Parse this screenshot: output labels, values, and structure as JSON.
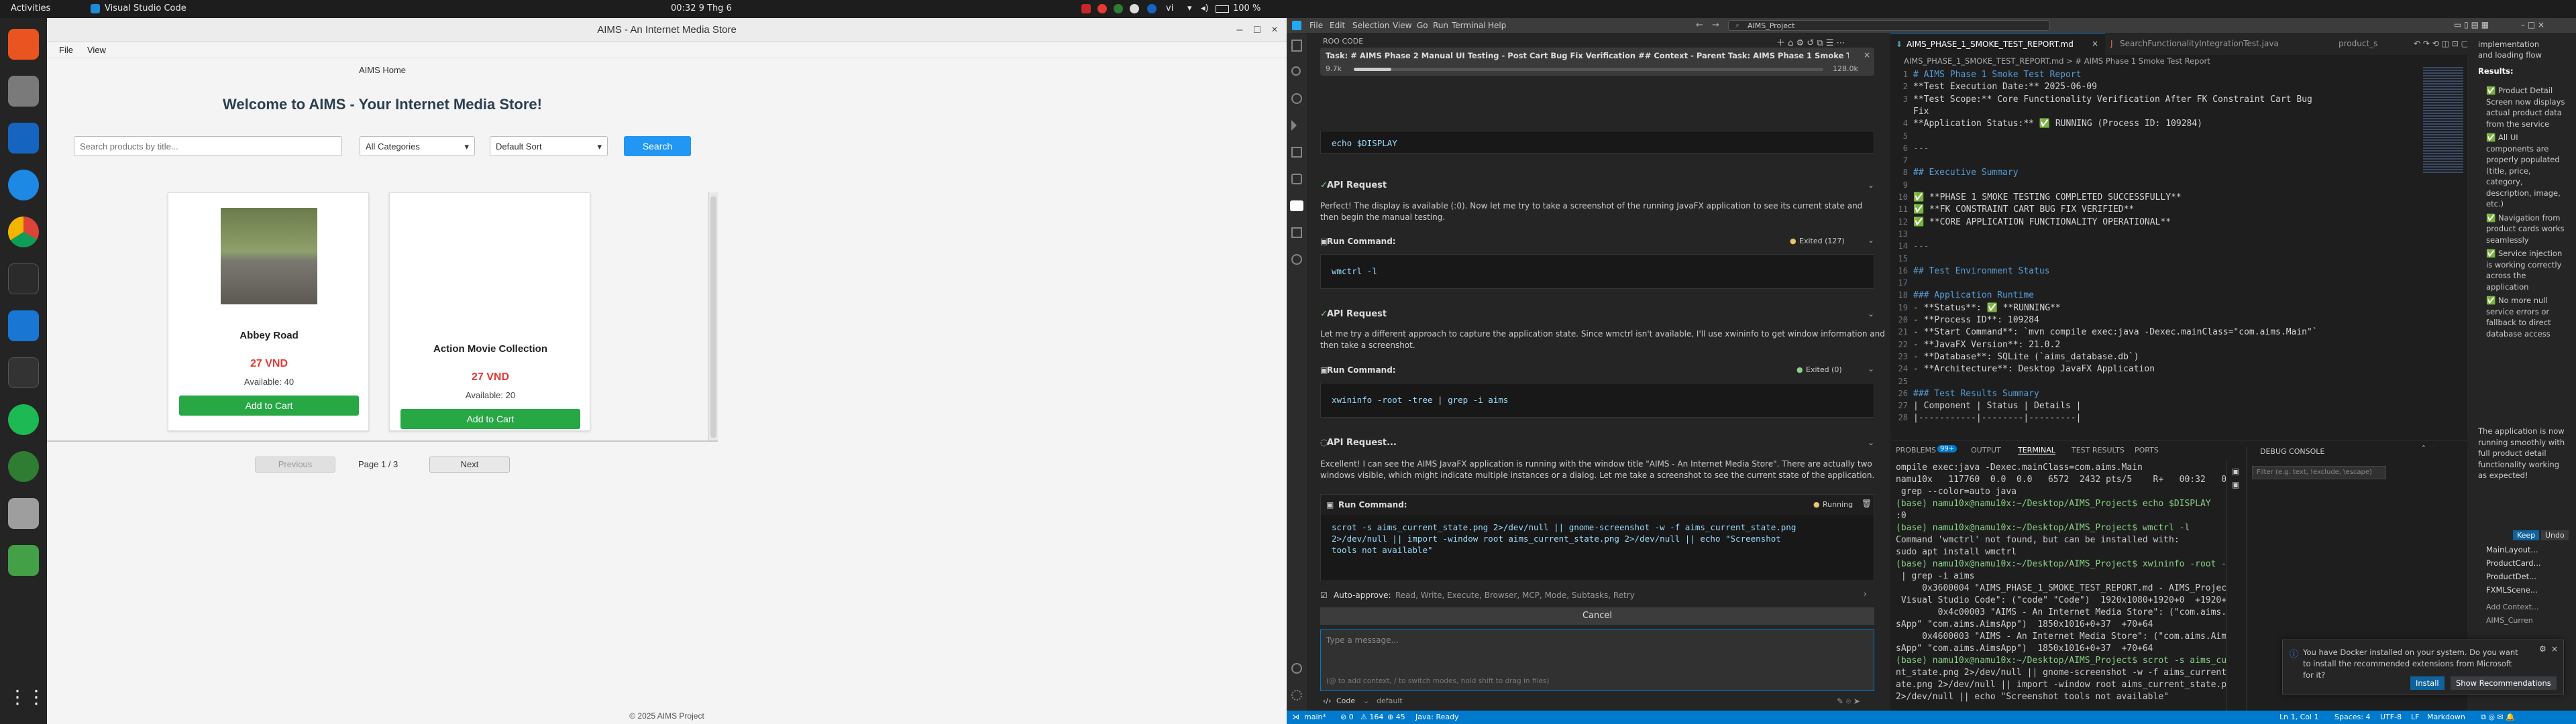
{
  "topbar": {
    "activities": "Activities",
    "app_name": "Visual Studio Code",
    "clock": "00:32  9 Thg 6",
    "lang": "vi",
    "battery": "100 %"
  },
  "dock": {
    "items": [
      "ubuntu-software-icon",
      "files-icon",
      "writer-icon",
      "help-icon",
      "chrome-icon",
      "terminal-icon",
      "vscode-icon",
      "monitor-icon",
      "spotify-icon",
      "xmind-icon",
      "disk-icon",
      "trash-icon",
      "show-apps-icon"
    ]
  },
  "aims": {
    "window_title": "AIMS - An Internet Media Store",
    "menu": [
      "File",
      "View"
    ],
    "header": "AIMS Home",
    "welcome": "Welcome to AIMS - Your Internet Media Store!",
    "search_placeholder": "Search products by title...",
    "category": "All Categories",
    "sort": "Default Sort",
    "search_btn": "Search",
    "products": [
      {
        "title": "Abbey Road",
        "price": "27 VND",
        "available": "Available: 40",
        "button": "Add to Cart"
      },
      {
        "title": "Action Movie Collection",
        "price": "27 VND",
        "available": "Available: 20",
        "button": "Add to Cart"
      }
    ],
    "pagination": {
      "prev": "Previous",
      "page": "Page 1 / 3",
      "next": "Next"
    },
    "footer": "© 2025 AIMS Project"
  },
  "vscode": {
    "menu": [
      "File",
      "Edit",
      "Selection",
      "View",
      "Go",
      "Run",
      "Terminal",
      "Help"
    ],
    "search": "AIMS_Project",
    "roo": {
      "title": "ROO CODE",
      "task": "Task: # AIMS Phase 2 Manual UI Testing - Post Cart Bug Fix Verification ## Context - Parent Task: AIMS Phase 1 Smoke Testing - C...",
      "tokens": "9.7k",
      "ctx": "128.0k",
      "cmd_echo": "echo $DISPLAY",
      "api1": "API Request",
      "msg1": "Perfect! The display is available (:0). Now let me try to take a screenshot of the running JavaFX application to see its current state and then begin the manual testing.",
      "run1": "Run Command:",
      "run1_status": "Exited (127)",
      "cmd1": "wmctrl -l",
      "api2": "API Request",
      "msg2a": "Let me try a different approach to capture the application state. Since wmctrl isn't available, I'll use xwininfo to get window information and",
      "msg2b": "then take a screenshot.",
      "run2": "Run Command:",
      "run2_status": "Exited (0)",
      "cmd2": "xwininfo -root -tree | grep -i aims",
      "api3": "API Request...",
      "msg3a": "Excellent! I can see the AIMS JavaFX application is running with the window title \"AIMS - An Internet Media Store\". There are actually two",
      "msg3b": "windows visible, which might indicate multiple instances or a dialog. Let me take a screenshot to see the current state of the application.",
      "run3": "Run Command:",
      "run3_status": "Running",
      "cmd3a": "scrot -s aims_current_state.png 2>/dev/null || gnome-screenshot -w -f aims_current_state.png",
      "cmd3b": "2>/dev/null || import -window root aims_current_state.png 2>/dev/null || echo \"Screenshot",
      "cmd3c": "tools not available\"",
      "auto": "Auto-approve:",
      "auto_list": "Read, Write, Execute, Browser, MCP, Mode, Subtasks, Retry",
      "cancel": "Cancel",
      "placeholder": "Type a message...",
      "hint": "(@ to add context, / to switch modes, hold shift to drag in files)",
      "mode": "Code",
      "profile": "default"
    },
    "tabs": [
      "AIMS_PHASE_1_SMOKE_TEST_REPORT.md",
      "SearchFunctionalityIntegrationTest.java",
      "product_s"
    ],
    "breadcrumb": "AIMS_PHASE_1_SMOKE_TEST_REPORT.md > # AIMS Phase 1 Smoke Test Report",
    "editor_lines": [
      {
        "n": "1",
        "t": "# AIMS Phase 1 Smoke Test Report",
        "c": "#569cd6"
      },
      {
        "n": "2",
        "t": "**Test Execution Date:** 2025-06-09",
        "c": "#d4d4d4"
      },
      {
        "n": "3",
        "t": "**Test Scope:** Core Functionality Verification After FK Constraint Cart Bug",
        "c": "#d4d4d4"
      },
      {
        "n": "",
        "t": "Fix",
        "c": "#d4d4d4"
      },
      {
        "n": "4",
        "t": "**Application Status:** ✅ RUNNING (Process ID: 109284)",
        "c": "#d4d4d4"
      },
      {
        "n": "5",
        "t": "",
        "c": "#d4d4d4"
      },
      {
        "n": "6",
        "t": "---",
        "c": "#808080"
      },
      {
        "n": "7",
        "t": "",
        "c": "#d4d4d4"
      },
      {
        "n": "8",
        "t": "## Executive Summary",
        "c": "#569cd6"
      },
      {
        "n": "9",
        "t": "",
        "c": "#d4d4d4"
      },
      {
        "n": "10",
        "t": "✅ **PHASE 1 SMOKE TESTING COMPLETED SUCCESSFULLY**",
        "c": "#d4d4d4"
      },
      {
        "n": "11",
        "t": "✅ **FK CONSTRAINT CART BUG FIX VERIFIED**",
        "c": "#d4d4d4"
      },
      {
        "n": "12",
        "t": "✅ **CORE APPLICATION FUNCTIONALITY OPERATIONAL**",
        "c": "#d4d4d4"
      },
      {
        "n": "13",
        "t": "",
        "c": "#d4d4d4"
      },
      {
        "n": "14",
        "t": "---",
        "c": "#808080"
      },
      {
        "n": "15",
        "t": "",
        "c": "#d4d4d4"
      },
      {
        "n": "16",
        "t": "## Test Environment Status",
        "c": "#569cd6"
      },
      {
        "n": "17",
        "t": "",
        "c": "#d4d4d4"
      },
      {
        "n": "18",
        "t": "### Application Runtime",
        "c": "#569cd6"
      },
      {
        "n": "19",
        "t": "- **Status**: ✅ **RUNNING**",
        "c": "#d4d4d4"
      },
      {
        "n": "20",
        "t": "- **Process ID**: 109284",
        "c": "#d4d4d4"
      },
      {
        "n": "21",
        "t": "- **Start Command**: `mvn compile exec:java -Dexec.mainClass=\"com.aims.Main\"`",
        "c": "#d4d4d4"
      },
      {
        "n": "22",
        "t": "- **JavaFX Version**: 21.0.2",
        "c": "#d4d4d4"
      },
      {
        "n": "23",
        "t": "- **Database**: SQLite (`aims_database.db`)",
        "c": "#d4d4d4"
      },
      {
        "n": "24",
        "t": "- **Architecture**: Desktop JavaFX Application",
        "c": "#d4d4d4"
      },
      {
        "n": "25",
        "t": "",
        "c": "#d4d4d4"
      },
      {
        "n": "26",
        "t": "### Test Results Summary",
        "c": "#569cd6"
      },
      {
        "n": "27",
        "t": "| Component | Status | Details |",
        "c": "#d4d4d4"
      },
      {
        "n": "28",
        "t": "|-----------|--------|---------|",
        "c": "#d4d4d4"
      }
    ],
    "panel_tabs": [
      "PROBLEMS",
      "OUTPUT",
      "TERMINAL",
      "TEST RESULTS",
      "PORTS"
    ],
    "problems_count": "99+",
    "terminal_lines": [
      "ompile exec:java -Dexec.mainClass=com.aims.Main",
      "namu10x   117760  0.0  0.0   6572  2432 pts/5    R+   00:32   0:00",
      " grep --color=auto java",
      "(base) namu10x@namu10x:~/Desktop/AIMS_Project$ echo $DISPLAY",
      ":0",
      "(base) namu10x@namu10x:~/Desktop/AIMS_Project$ wmctrl -l",
      "Command 'wmctrl' not found, but can be installed with:",
      "sudo apt install wmctrl",
      "(base) namu10x@namu10x:~/Desktop/AIMS_Project$ xwininfo -root -tree",
      " | grep -i aims",
      "     0x3600004 \"AIMS_PHASE_1_SMOKE_TEST_REPORT.md - AIMS_Project -",
      " Visual Studio Code\": (\"code\" \"Code\")  1920x1080+1920+0  +1920+0",
      "        0x4c00003 \"AIMS - An Internet Media Store\": (\"com.aims.Aim",
      "sApp\" \"com.aims.AimsApp\")  1850x1016+0+37  +70+64",
      "     0x4600003 \"AIMS - An Internet Media Store\": (\"com.aims.Aim",
      "sApp\" \"com.aims.AimsApp\")  1850x1016+0+37  +70+64",
      "(base) namu10x@namu10x:~/Desktop/AIMS_Project$ scrot -s aims_curre",
      "nt_state.png 2>/dev/null || gnome-screenshot -w -f aims_current_st",
      "ate.png 2>/dev/null || import -window root aims_current_state.png",
      "2>/dev/null || echo \"Screenshot tools not available\""
    ],
    "debug_console": "DEBUG CONSOLE",
    "filter_placeholder": "Filter (e.g. text, !exclude, \\escape)",
    "right_lines": [
      "implementation",
      "and loading flow",
      "Results:"
    ],
    "right_bullets": [
      "✅ Product Detail Screen now displays actual product data from the service",
      "✅ All UI components are properly populated (title, price, category, description, image, etc.)",
      "✅ Navigation from product cards works seamlessly",
      "✅ Service injection is working correctly across the application",
      "✅ No more null service errors or fallback to direct database access"
    ],
    "right_para": "The application is now running smoothly with full product detail functionality working as expected!",
    "keep": "Keep",
    "undo": "Undo",
    "changed_files": [
      "MainLayout...",
      "ProductCard...",
      "ProductDet...",
      "FXMLScene..."
    ],
    "add_context": "Add Context...",
    "current_file": "AIMS_Curren",
    "notif_text": "You have Docker installed on your system. Do you want to install the recommended extensions from Microsoft for it?",
    "notif_install": "Install",
    "notif_show": "Show Recommendations",
    "status_left": [
      "main*",
      "⊘ 0",
      "⚠ 164",
      "⊕ 45",
      "Java: Ready"
    ],
    "status_right": [
      "Ln 1, Col 1",
      "Spaces: 4",
      "UTF-8",
      "LF",
      "Markdown"
    ]
  },
  "colors": {
    "accent": "#007acc",
    "search_btn": "#2196f3",
    "add_btn": "#28a745",
    "price": "#e53935"
  }
}
